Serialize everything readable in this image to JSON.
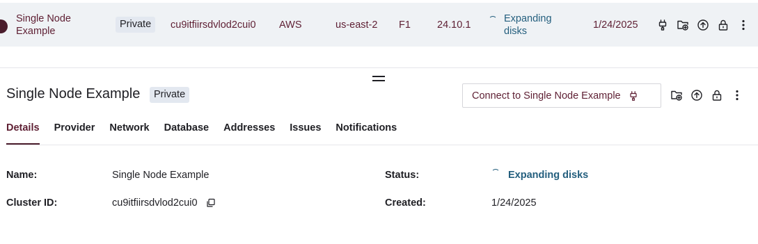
{
  "row": {
    "name": "Single Node Example",
    "privacy": "Private",
    "cluster_id": "cu9itfiirsdvlod2cui0",
    "provider": "AWS",
    "region": "us-east-2",
    "tier": "F1",
    "version": "24.10.1",
    "status": "Expanding disks",
    "created": "1/24/2025",
    "actions": [
      "plug-icon",
      "folder-add-icon",
      "upload-circle-icon",
      "lock-icon",
      "more-vertical-icon"
    ]
  },
  "detail": {
    "title": "Single Node Example",
    "privacy": "Private",
    "connect_label": "Connect to Single Node Example",
    "tabs": [
      {
        "label": "Details",
        "active": true
      },
      {
        "label": "Provider"
      },
      {
        "label": "Network"
      },
      {
        "label": "Database"
      },
      {
        "label": "Addresses"
      },
      {
        "label": "Issues"
      },
      {
        "label": "Notifications"
      }
    ],
    "fields": {
      "name_label": "Name:",
      "name_value": "Single Node Example",
      "cluster_label": "Cluster ID:",
      "cluster_value": "cu9itfiirsdvlod2cui0",
      "status_label": "Status:",
      "status_value": "Expanding disks",
      "created_label": "Created:",
      "created_value": "1/24/2025"
    }
  },
  "colors": {
    "accent": "#5e1f33",
    "status": "#245f7e",
    "row_bg": "#eff2f5",
    "badge_bg": "#e3e8f0"
  }
}
